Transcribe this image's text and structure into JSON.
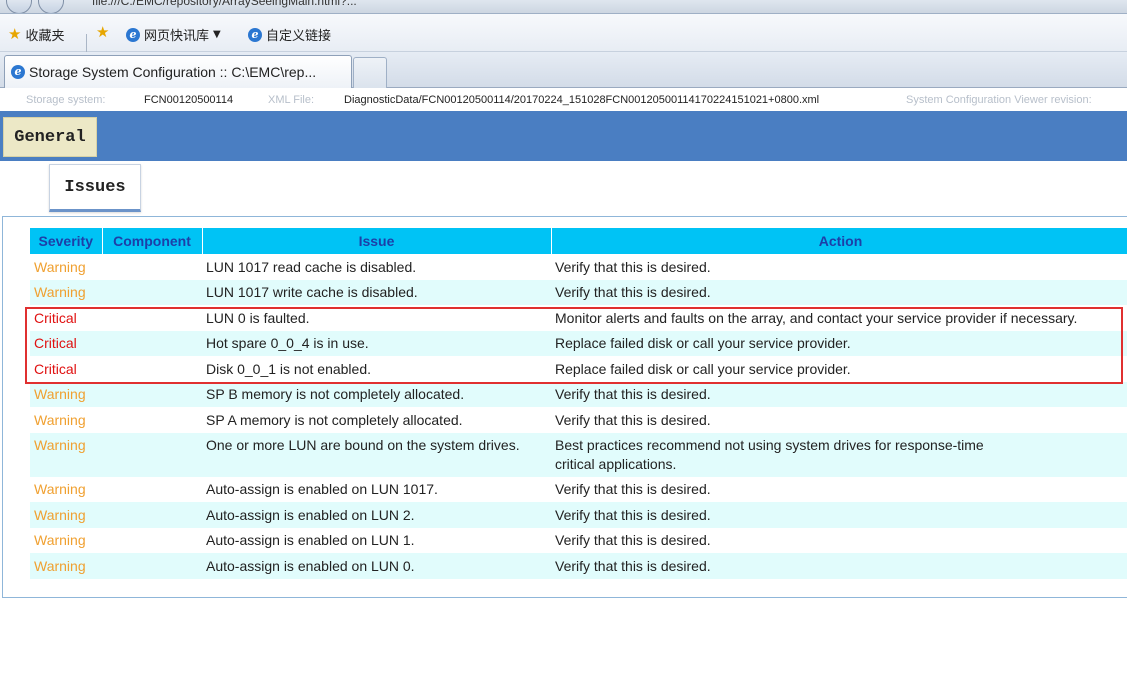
{
  "address_bar": {
    "url": "file:///C:/EMC/repository/ArraySeeingMain.html?..."
  },
  "favorites_bar": {
    "favorites_label": "收藏夹",
    "items": [
      {
        "label": "网页快讯库"
      },
      {
        "label": "自定义链接"
      }
    ]
  },
  "tabs": [
    {
      "title": "Storage System Configuration :: C:\\EMC\\rep..."
    }
  ],
  "info_strip": {
    "storage_system_label": "Storage system:",
    "storage_system_value": "FCN00120500114",
    "xml_file_label": "XML File:",
    "xml_file_value": "DiagnosticData/FCN00120500114/20170224_151028FCN00120500114170224151021+0800.xml",
    "viewer_revision_label": "System Configuration Viewer revision:"
  },
  "page_tabs": {
    "general": "General",
    "issues": "Issues"
  },
  "table": {
    "headers": [
      "Severity",
      "Component",
      "Issue",
      "Action"
    ],
    "rows": [
      {
        "severity": "Warning",
        "component": "",
        "issue": "LUN 1017 read cache is disabled.",
        "action": "Verify that this is desired."
      },
      {
        "severity": "Warning",
        "component": "",
        "issue": "LUN 1017 write cache is disabled.",
        "action": "Verify that this is desired."
      },
      {
        "severity": "Critical",
        "component": "",
        "issue": "LUN 0 is faulted.",
        "action": "Monitor alerts and faults on the array, and contact your service provider if necessary."
      },
      {
        "severity": "Critical",
        "component": "",
        "issue": "Hot spare 0_0_4 is in use.",
        "action": "Replace failed disk or call your service provider."
      },
      {
        "severity": "Critical",
        "component": "",
        "issue": "Disk 0_0_1 is not enabled.",
        "action": "Replace failed disk or call your service provider."
      },
      {
        "severity": "Warning",
        "component": "",
        "issue": "SP B memory is not completely allocated.",
        "action": "Verify that this is desired."
      },
      {
        "severity": "Warning",
        "component": "",
        "issue": "SP A memory is not completely allocated.",
        "action": "Verify that this is desired."
      },
      {
        "severity": "Warning",
        "component": "",
        "issue": "One or more LUN are bound on the system drives.",
        "action": "Best practices recommend not using system drives for response-time critical applications."
      },
      {
        "severity": "Warning",
        "component": "",
        "issue": "Auto-assign is enabled on LUN 1017.",
        "action": "Verify that this is desired."
      },
      {
        "severity": "Warning",
        "component": "",
        "issue": "Auto-assign is enabled on LUN 2.",
        "action": "Verify that this is desired."
      },
      {
        "severity": "Warning",
        "component": "",
        "issue": "Auto-assign is enabled on LUN 1.",
        "action": "Verify that this is desired."
      },
      {
        "severity": "Warning",
        "component": "",
        "issue": "Auto-assign is enabled on LUN 0.",
        "action": "Verify that this is desired."
      }
    ]
  },
  "colors": {
    "header_bg": "#00c3f5",
    "header_text": "#1d3fa8",
    "warning": "#f0a030",
    "critical": "#e01010",
    "band": "#4a7ec2",
    "highlight": "#e03030"
  }
}
